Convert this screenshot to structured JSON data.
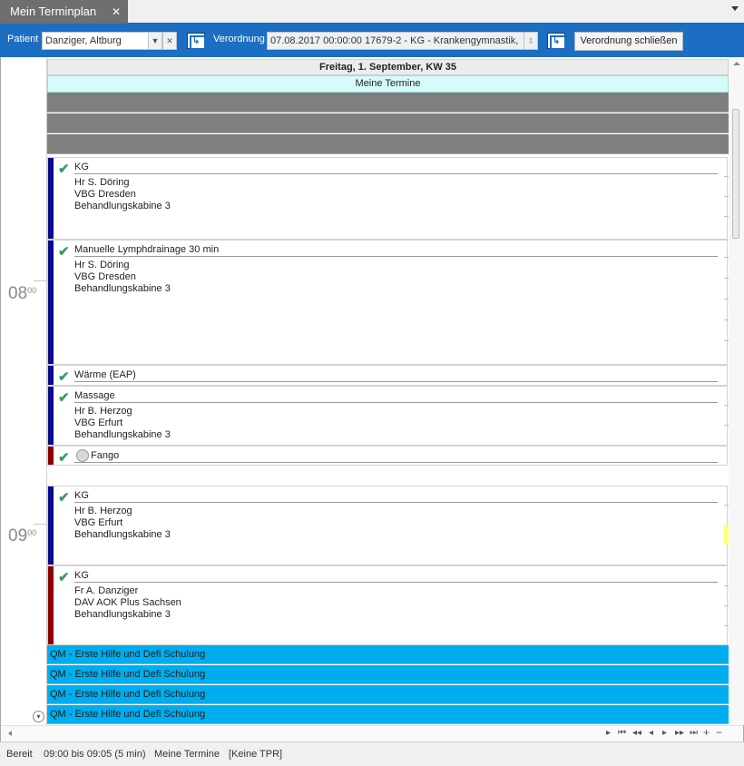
{
  "tab": {
    "title": "Mein Terminplan",
    "close": "✕"
  },
  "toolbar": {
    "patient_label": "Patient",
    "patient_value": "Danziger, Altburg",
    "verordnung_label": "Verordnung",
    "verordnung_value": "07.08.2017 00:00:00 17679-2 - KG - Krankengymnastik,",
    "close_button": "Verordnung schließen",
    "clear_glyph": "✕",
    "dropdown_glyph": "▼",
    "spin_glyph": "⇕"
  },
  "scheduler": {
    "day_header": "Freitag, 1. September, KW 35",
    "resource_header": "Meine Termine",
    "hours": [
      {
        "h": "08",
        "m": "00"
      },
      {
        "h": "09",
        "m": "00"
      }
    ],
    "appointments": [
      {
        "title": "KG",
        "lines": [
          "Hr S. Döring",
          "VBG Dresden",
          "Behandlungskabine 3"
        ],
        "color": "#0a0a8c",
        "checked": true
      },
      {
        "title": "Manuelle Lymphdrainage 30 min",
        "lines": [
          "Hr S. Döring",
          "VBG Dresden",
          "Behandlungskabine 3"
        ],
        "color": "#0a0a8c",
        "checked": true
      },
      {
        "title": "Wärme (EAP)",
        "lines": [],
        "color": "#0a0a8c",
        "checked": true
      },
      {
        "title": "Massage",
        "lines": [
          "Hr B. Herzog",
          "VBG Erfurt",
          "Behandlungskabine 3"
        ],
        "color": "#0a0a8c",
        "checked": true
      },
      {
        "title": "Fango",
        "lines": [],
        "color": "#8b0000",
        "checked": true,
        "icon": "fango-coin-icon"
      },
      {
        "title": "KG",
        "lines": [
          "Hr B. Herzog",
          "VBG Erfurt",
          "Behandlungskabine 3"
        ],
        "color": "#0a0a8c",
        "checked": true
      },
      {
        "title": "KG",
        "lines": [
          "Fr A. Danziger",
          "DAV AOK Plus Sachsen",
          "Behandlungskabine 3"
        ],
        "color": "#8b0000",
        "checked": true
      }
    ],
    "qm_events": [
      "QM - Erste Hilfe und Defi Schulung",
      "QM - Erste Hilfe und Defi Schulung",
      "QM - Erste Hilfe und Defi Schulung",
      "QM - Erste Hilfe und Defi Schulung"
    ],
    "check_glyph": "✔",
    "nav_glyphs": [
      "▸",
      "⏮",
      "◂◂",
      "◂",
      "▸",
      "▸▸",
      "⏭",
      "+",
      "−"
    ]
  },
  "status": {
    "state": "Bereit",
    "time": "09:00 bis 09:05 (5 min)",
    "resource": "Meine Termine",
    "tpr": "[Keine TPR]"
  },
  "colors": {
    "accent": "#1b6ec2",
    "qm": "#00adee",
    "blocked": "#7f7f7f",
    "resource_header": "#d6fbfb"
  }
}
